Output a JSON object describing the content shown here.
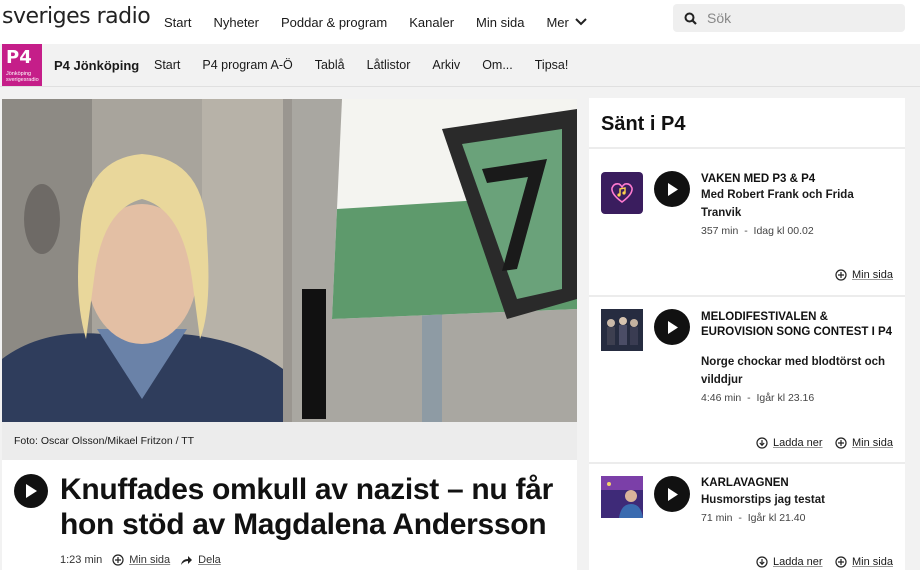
{
  "brand": {
    "logo_text": "sveriges radio"
  },
  "topnav": [
    "Start",
    "Nyheter",
    "Poddar & program",
    "Kanaler",
    "Min sida"
  ],
  "mer_label": "Mer",
  "search": {
    "placeholder": "Sök"
  },
  "channel": {
    "logo_big": "P4",
    "logo_small_1": "Jönköping",
    "logo_small_2": "sverigesradio",
    "station_name": "P4 Jönköping",
    "accent": "#c51e89"
  },
  "subnav": [
    "Start",
    "P4 program A-Ö",
    "Tablå",
    "Låtlistor",
    "Arkiv",
    "Om...",
    "Tipsa!"
  ],
  "article": {
    "photo_credit": "Foto: Oscar Olsson/Mikael Fritzon / TT",
    "headline": "Knuffades omkull av nazist – nu får hon stöd av Magdalena Andersson",
    "duration": "1:23 min",
    "min_sida": "Min sida",
    "dela": "Dela"
  },
  "panel": {
    "title": "Sänt i P4",
    "items": [
      {
        "title": "VAKEN MED P3 & P4",
        "subtitle": "Med Robert Frank och Frida Tranvik",
        "duration": "357 min",
        "time": "Idag kl 00.02",
        "actions": [
          "Min sida"
        ]
      },
      {
        "title": "MELODIFESTIVALEN & EUROVISION SONG CONTEST I P4",
        "subtitle": "Norge chockar med blodtörst och vilddjur",
        "duration": "4:46 min",
        "time": "Igår kl 23.16",
        "actions": [
          "Ladda ner",
          "Min sida"
        ]
      },
      {
        "title": "KARLAVAGNEN",
        "subtitle": "Husmorstips jag testat",
        "duration": "71 min",
        "time": "Igår kl 21.40",
        "actions": [
          "Ladda ner",
          "Min sida"
        ]
      }
    ]
  }
}
